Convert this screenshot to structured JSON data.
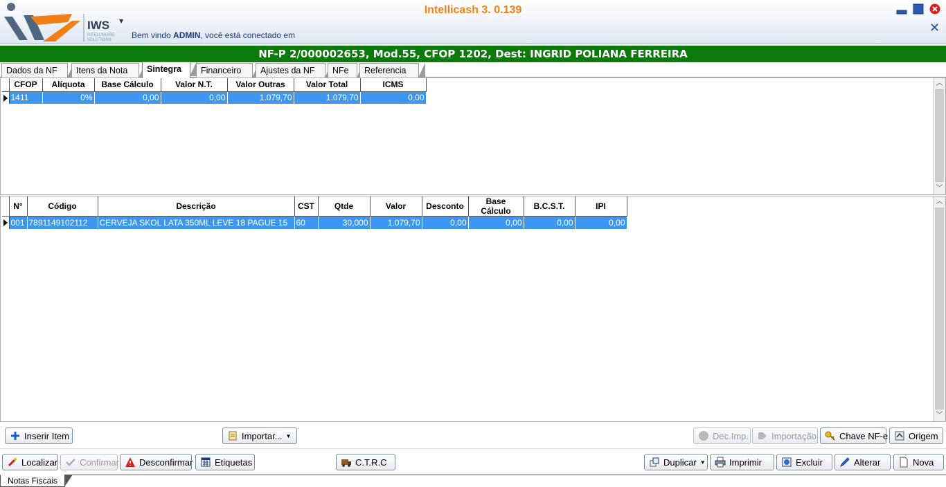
{
  "app": {
    "title": "Intellicash 3. 0.139",
    "logo_text": "IWS",
    "logo_subtext": "INTELLIWARE SOLUTIONS",
    "welcome_prefix": "Bem vindo ",
    "welcome_user": "ADMIN",
    "welcome_suffix": ", você está conectado em"
  },
  "document_title": "NF-P 2/000002653, Mod.55, CFOP 1202, Dest: INGRID POLIANA FERREIRA",
  "tabs": [
    {
      "label": "Dados da NF"
    },
    {
      "label": "Itens da Nota"
    },
    {
      "label": "Sintegra",
      "active": true
    },
    {
      "label": "Financeiro"
    },
    {
      "label": "Ajustes da NF"
    },
    {
      "label": "NFe"
    },
    {
      "label": "Referencia"
    }
  ],
  "sintegra_grid": {
    "columns": [
      "CFOP",
      "Alíquota",
      "Base Cálculo",
      "Valor N.T.",
      "Valor Outras",
      "Valor Total",
      "ICMS"
    ],
    "rows": [
      [
        "1411",
        "0%",
        "0,00",
        "0,00",
        "1.079,70",
        "1.079,70",
        "0,00"
      ]
    ]
  },
  "items_grid": {
    "columns": [
      "N°",
      "Código",
      "Descrição",
      "CST",
      "Qtde",
      "Valor",
      "Desconto",
      "Base Cálculo",
      "B.C.S.T.",
      "IPI"
    ],
    "rows": [
      [
        "001",
        "7891149102112",
        "CERVEJA SKOL LATA 350ML LEVE 18 PAGUE 15",
        "60",
        "30,000",
        "1.079,70",
        "0,00",
        "0,00",
        "0,00",
        "0,00"
      ]
    ]
  },
  "buttons_row1": {
    "insert_item": "Inserir Item",
    "import": "Importar...",
    "dec_imp": "Dec.Imp.",
    "importacao": "Importação",
    "chave_nfe": "Chave NF-e",
    "origem": "Origem"
  },
  "buttons_row2": {
    "localizar": "Localizar",
    "confirmar": "Confirmar",
    "desconfirmar": "Desconfirmar",
    "etiquetas": "Etiquetas",
    "ctrc": "C.T.R.C",
    "duplicar": "Duplicar",
    "imprimir": "Imprimir",
    "excluir": "Excluir",
    "alterar": "Alterar",
    "nova": "Nova"
  },
  "status_tab": "Notas Fiscais",
  "colors": {
    "title_bar": "#0a7a0a",
    "selection": "#3d97f0",
    "app_title": "#f07f16"
  }
}
